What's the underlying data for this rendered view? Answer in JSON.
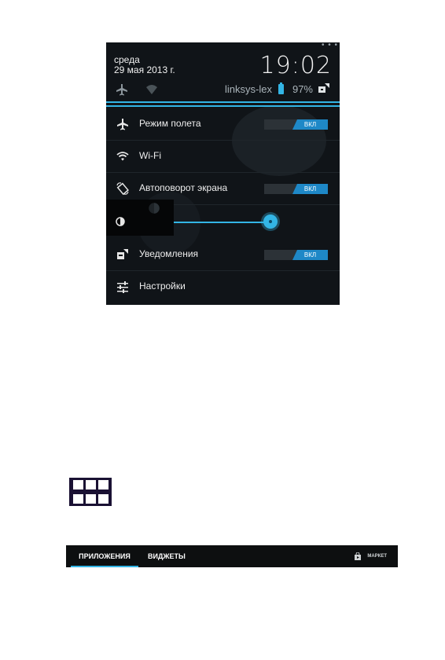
{
  "panel": {
    "top_dots": "• • •",
    "day": "среда",
    "date": "29 мая 2013 г.",
    "time": "19:02",
    "network": "linksys-lex",
    "battery": "97%",
    "rows": [
      {
        "label": "Режим полета",
        "icon": "airplane-icon",
        "toggle": "ВКЛ"
      },
      {
        "label": "Wi-Fi",
        "icon": "wifi-icon"
      },
      {
        "label": "Автоповорот экрана",
        "icon": "rotate-icon",
        "toggle": "ВКЛ"
      },
      {
        "label": "",
        "icon": "brightness-icon",
        "brightness": 0.78
      },
      {
        "label": "Уведомления",
        "icon": "notifications-icon",
        "toggle": "ВКЛ"
      },
      {
        "label": "Настройки",
        "icon": "settings-sliders-icon"
      }
    ],
    "accent": "#33b5e5"
  },
  "apps_icon": {
    "icon": "app-grid-icon"
  },
  "tabbar": {
    "tabs": [
      "ПРИЛОЖЕНИЯ",
      "ВИДЖЕТЫ"
    ],
    "active_tab": "ПРИЛОЖЕНИЯ",
    "market": "МАРКЕТ",
    "market_icon": "market-bag-icon"
  }
}
